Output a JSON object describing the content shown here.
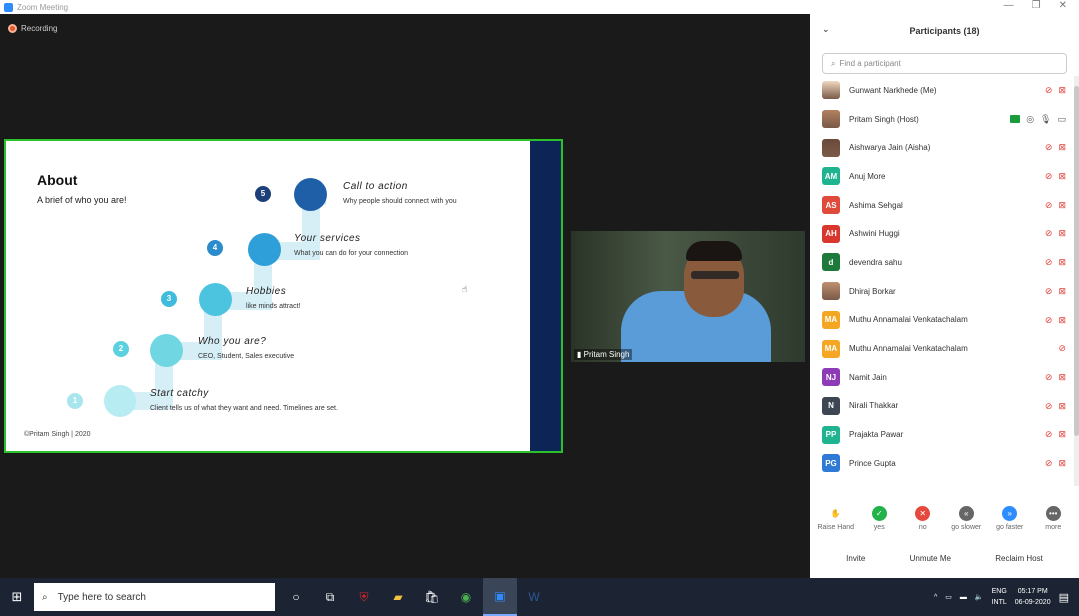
{
  "window": {
    "title": "Zoom Meeting",
    "controls": [
      "—",
      "❐",
      "✕"
    ]
  },
  "stage": {
    "recording_label": "Recording",
    "video_name": "Pritam Singh",
    "slide": {
      "title": "About",
      "subtitle": "A brief of who you are!",
      "footer": "©Pritam Singh | 2020",
      "steps": [
        {
          "num": "1",
          "title": "Start catchy",
          "desc": "Client tells us of what they want and need. Timelines are set."
        },
        {
          "num": "2",
          "title": "Who you are?",
          "desc": "CEO, Student, Sales executive"
        },
        {
          "num": "3",
          "title": "Hobbies",
          "desc": "like minds attract!"
        },
        {
          "num": "4",
          "title": "Your services",
          "desc": "What you can do for your connection"
        },
        {
          "num": "5",
          "title": "Call to action",
          "desc": "Why people should connect with you"
        }
      ]
    }
  },
  "panel": {
    "title": "Participants (18)",
    "search_placeholder": "Find a participant",
    "participants": [
      {
        "name": "Gunwant Narkhede (Me)",
        "initials": "",
        "color": "#f0d9c0",
        "photo": true,
        "host": false
      },
      {
        "name": "Pritam Singh (Host)",
        "initials": "",
        "color": "#b38060",
        "photo": true,
        "host": true
      },
      {
        "name": "Aishwarya Jain (Aisha)",
        "initials": "",
        "color": "#6a4a3a",
        "photo": true,
        "host": false
      },
      {
        "name": "Anuj More",
        "initials": "AM",
        "color": "#1fb390",
        "photo": false,
        "host": false
      },
      {
        "name": "Ashima Sehgal",
        "initials": "AS",
        "color": "#e04a3a",
        "photo": false,
        "host": false
      },
      {
        "name": "Ashwini Huggi",
        "initials": "AH",
        "color": "#d9362e",
        "photo": false,
        "host": false
      },
      {
        "name": "devendra sahu",
        "initials": "d",
        "color": "#1e7a3a",
        "photo": false,
        "host": false
      },
      {
        "name": "Dhiraj Borkar",
        "initials": "",
        "color": "#c09070",
        "photo": true,
        "host": false
      },
      {
        "name": "Muthu Annamalai Venkatachalam",
        "initials": "MA",
        "color": "#f5a623",
        "photo": false,
        "host": false
      },
      {
        "name": "Muthu Annamalai Venkatachalam",
        "initials": "MA",
        "color": "#f5a623",
        "photo": false,
        "host": false,
        "mic_only": true
      },
      {
        "name": "Namit Jain",
        "initials": "NJ",
        "color": "#8e3bb8",
        "photo": false,
        "host": false
      },
      {
        "name": "Nirali Thakkar",
        "initials": "N",
        "color": "#3d4652",
        "photo": false,
        "host": false
      },
      {
        "name": "Prajakta Pawar",
        "initials": "PP",
        "color": "#1fb390",
        "photo": false,
        "host": false
      },
      {
        "name": "Prince Gupta",
        "initials": "PG",
        "color": "#2d7bd6",
        "photo": false,
        "host": false
      }
    ],
    "reactions": [
      {
        "label": "Raise Hand",
        "icon": "✋",
        "color": "#fff"
      },
      {
        "label": "yes",
        "icon": "✓",
        "color": "#21b24a"
      },
      {
        "label": "no",
        "icon": "✕",
        "color": "#e5483c"
      },
      {
        "label": "go slower",
        "icon": "«",
        "color": "#666"
      },
      {
        "label": "go faster",
        "icon": "»",
        "color": "#2d8cff"
      },
      {
        "label": "more",
        "icon": "•••",
        "color": "#666"
      }
    ],
    "buttons": {
      "invite": "Invite",
      "unmute": "Unmute Me",
      "reclaim": "Reclaim Host"
    }
  },
  "taskbar": {
    "search_placeholder": "Type here to search",
    "lang1": "ENG",
    "lang2": "INTL",
    "time": "05:17 PM",
    "date": "06-09-2020"
  }
}
